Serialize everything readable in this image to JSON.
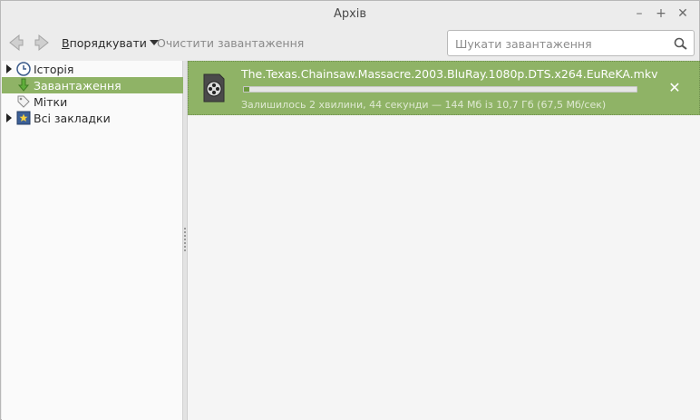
{
  "window": {
    "title": "Архів",
    "controls": {
      "minimize": "–",
      "maximize": "+",
      "close": "✕"
    }
  },
  "toolbar": {
    "back_icon": "back-arrow-icon",
    "forward_icon": "forward-arrow-icon",
    "organize_label_accel": "В",
    "organize_label_rest": "порядкувати",
    "clear_label": "Очистити завантаження",
    "search": {
      "placeholder": "Шукати завантаження",
      "value": "",
      "icon": "search-icon"
    }
  },
  "sidebar": {
    "items": [
      {
        "label": "Історія",
        "icon": "clock-icon",
        "expandable": true,
        "selected": false
      },
      {
        "label": "Завантаження",
        "icon": "download-arrow-icon",
        "expandable": false,
        "selected": true
      },
      {
        "label": "Мітки",
        "icon": "tag-icon",
        "expandable": false,
        "selected": false
      },
      {
        "label": "Всі закладки",
        "icon": "bookmarks-star-icon",
        "expandable": true,
        "selected": false
      }
    ]
  },
  "downloads": [
    {
      "filename": "The.Texas.Chainsaw.Massacre.2003.BluRay.1080p.DTS.x264.EuReKA.mkv",
      "status": "Залишилось 2 хвилини, 44 секунди — 144 Мб із 10,7 Гб (67,5 Мб/сек)",
      "progress": 0.013,
      "icon": "video-file-icon",
      "cancel": "✕"
    }
  ],
  "colors": {
    "selection": "#8fb366",
    "progress_fill": "#6c9a3e"
  }
}
